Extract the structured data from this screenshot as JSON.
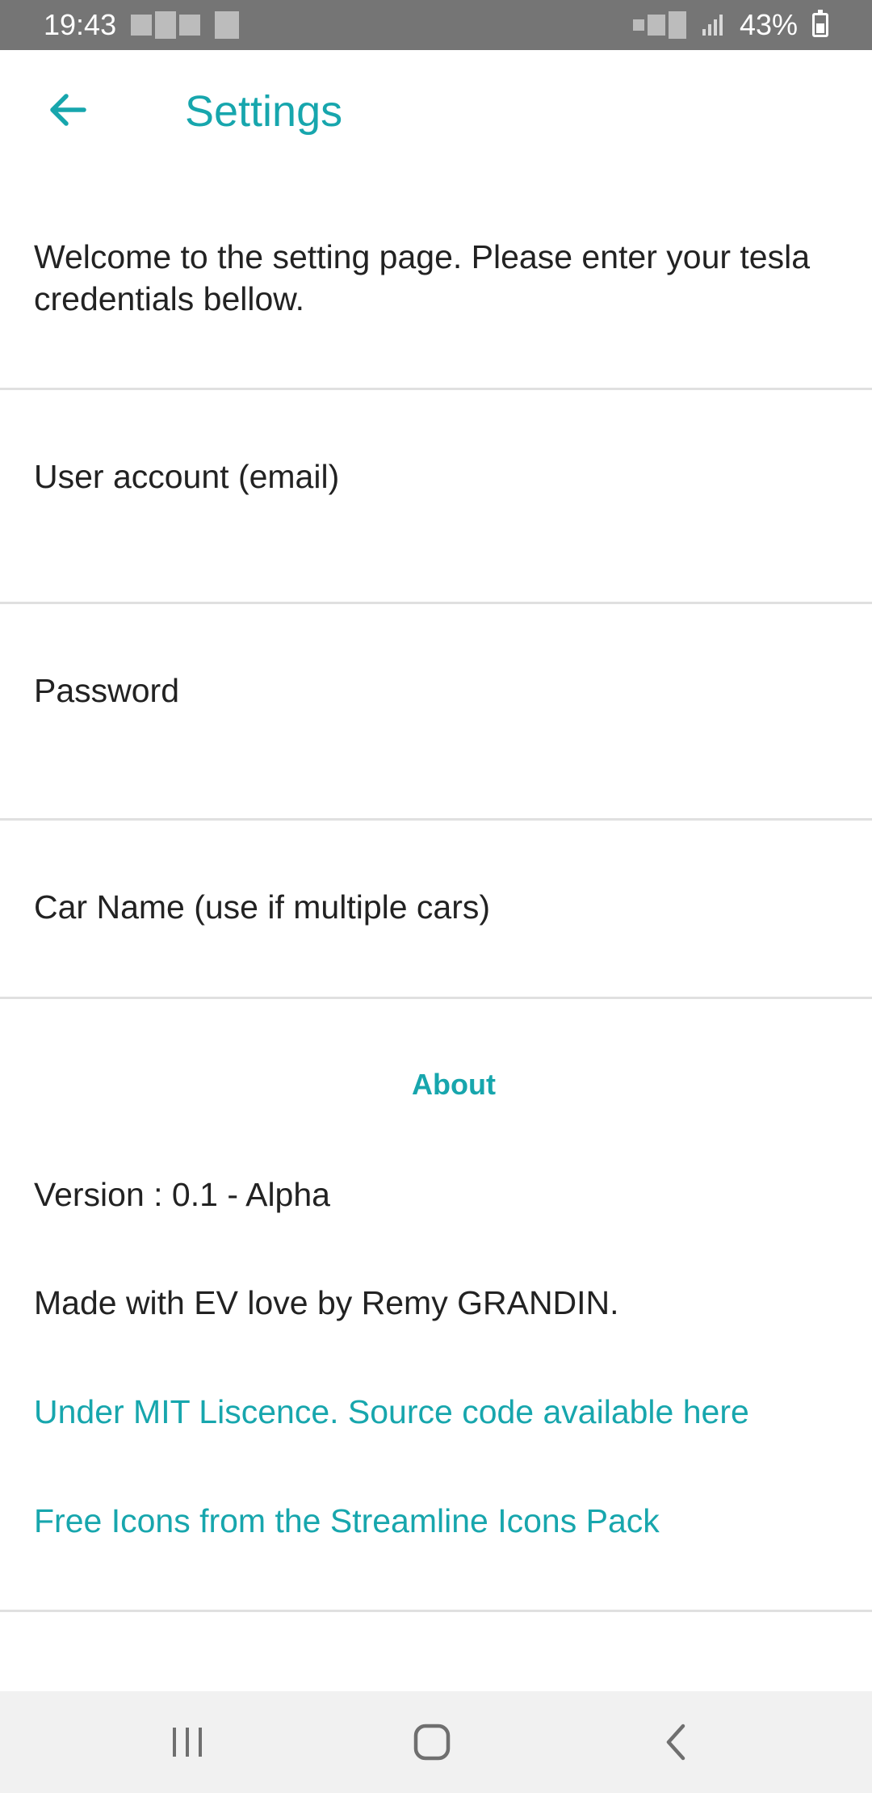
{
  "status_bar": {
    "time": "19:43",
    "battery": "43%"
  },
  "app_bar": {
    "back_icon": "arrow-left-icon",
    "title": "Settings"
  },
  "intro_text": "Welcome to the setting page. Please enter your tesla credentials bellow.",
  "fields": [
    {
      "label": "User account (email)"
    },
    {
      "label": "Password"
    },
    {
      "label": "Car Name (use if multiple cars)"
    }
  ],
  "about": {
    "header": "About",
    "version": "Version : 0.1 - Alpha",
    "credit": "Made with EV love by Remy GRANDIN.",
    "license_link": "Under MIT Liscence. Source code available here",
    "icons_link": "Free Icons from the Streamline Icons Pack"
  },
  "nav_bar": {
    "recents_icon": "recents-icon",
    "home_icon": "home-icon",
    "back_icon": "back-chevron-icon"
  },
  "colors": {
    "accent": "#17a6ad",
    "status_bar": "#757575",
    "nav_bar": "#f1f1f1",
    "divider": "#e0e0e0"
  }
}
